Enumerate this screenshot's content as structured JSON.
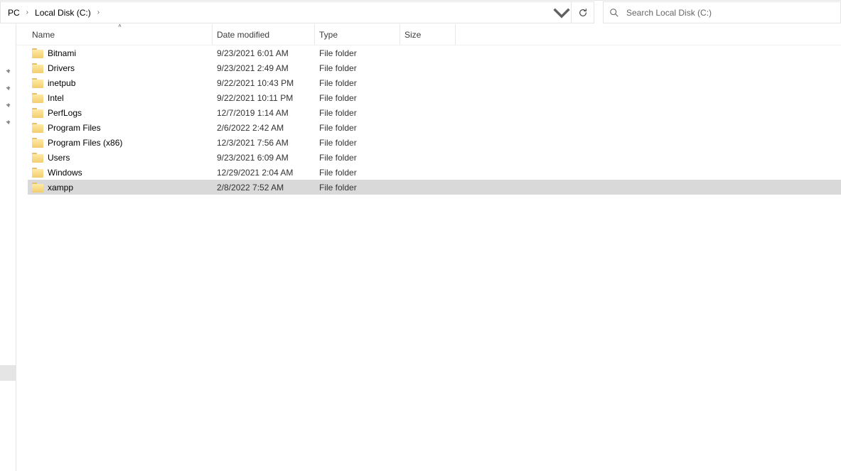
{
  "breadcrumb": {
    "item0": "PC",
    "item1": "Local Disk (C:)"
  },
  "search": {
    "placeholder": "Search Local Disk (C:)"
  },
  "columns": {
    "name": "Name",
    "date": "Date modified",
    "type": "Type",
    "size": "Size"
  },
  "items": [
    {
      "name": "Bitnami",
      "date": "9/23/2021 6:01 AM",
      "type": "File folder",
      "size": "",
      "selected": false
    },
    {
      "name": "Drivers",
      "date": "9/23/2021 2:49 AM",
      "type": "File folder",
      "size": "",
      "selected": false
    },
    {
      "name": "inetpub",
      "date": "9/22/2021 10:43 PM",
      "type": "File folder",
      "size": "",
      "selected": false
    },
    {
      "name": "Intel",
      "date": "9/22/2021 10:11 PM",
      "type": "File folder",
      "size": "",
      "selected": false
    },
    {
      "name": "PerfLogs",
      "date": "12/7/2019 1:14 AM",
      "type": "File folder",
      "size": "",
      "selected": false
    },
    {
      "name": "Program Files",
      "date": "2/6/2022 2:42 AM",
      "type": "File folder",
      "size": "",
      "selected": false
    },
    {
      "name": "Program Files (x86)",
      "date": "12/3/2021 7:56 AM",
      "type": "File folder",
      "size": "",
      "selected": false
    },
    {
      "name": "Users",
      "date": "9/23/2021 6:09 AM",
      "type": "File folder",
      "size": "",
      "selected": false
    },
    {
      "name": "Windows",
      "date": "12/29/2021 2:04 AM",
      "type": "File folder",
      "size": "",
      "selected": false
    },
    {
      "name": "xampp",
      "date": "2/8/2022 7:52 AM",
      "type": "File folder",
      "size": "",
      "selected": true
    }
  ]
}
